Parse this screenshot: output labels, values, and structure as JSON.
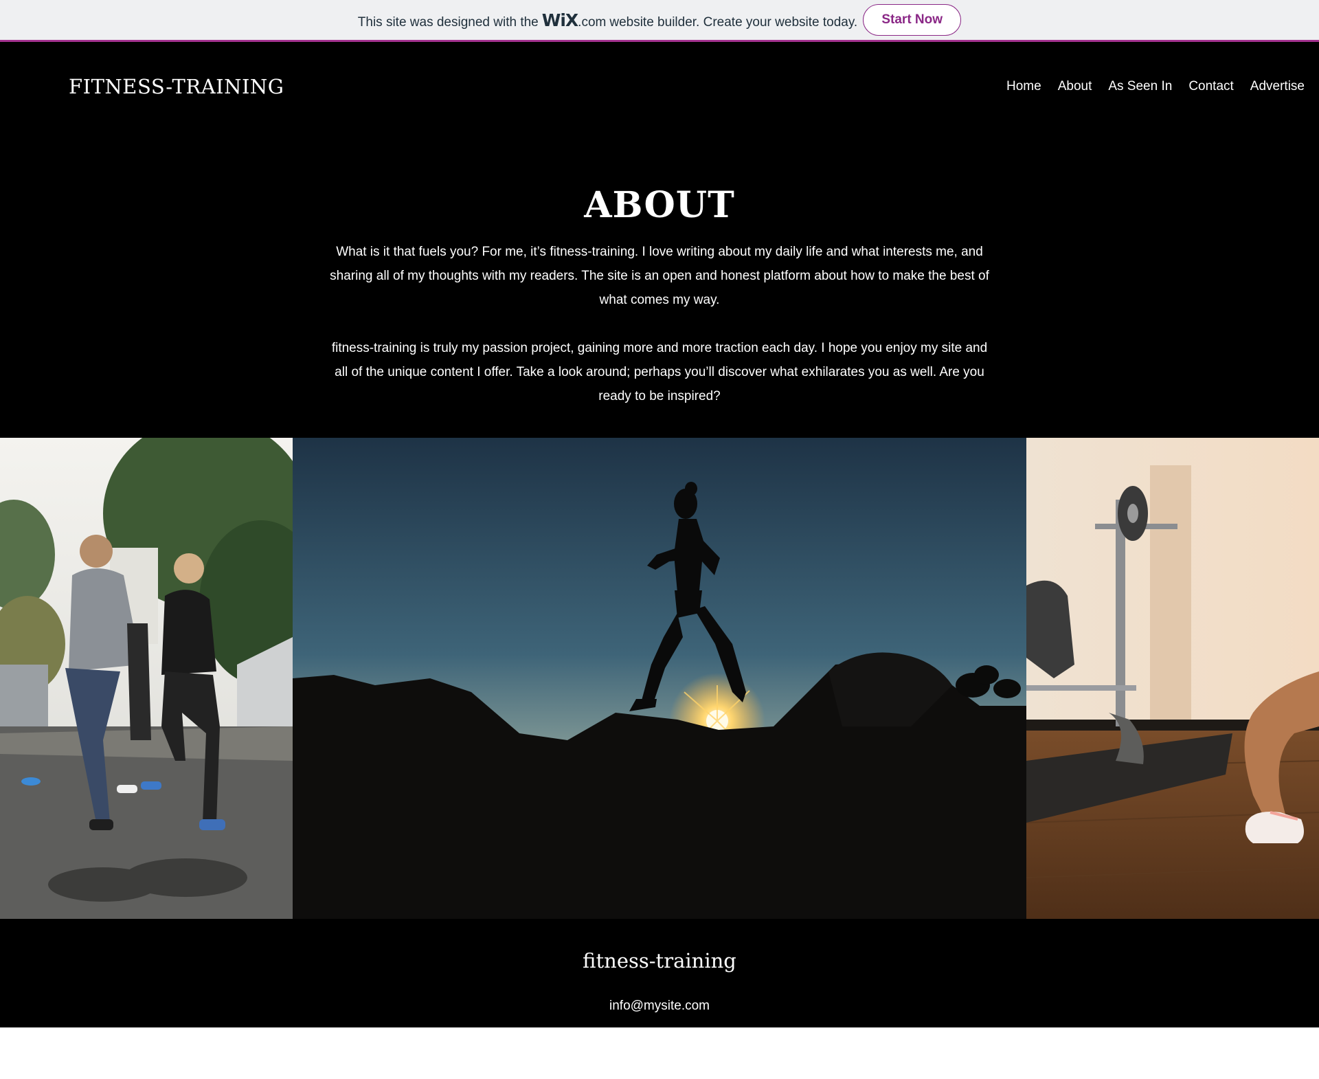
{
  "banner": {
    "prefix": "This site was designed with the",
    "logo": "WiX",
    "dotcom": ".com",
    "suffix": "website builder. Create your website today.",
    "button_label": "Start Now",
    "accent_color": "#a3328f"
  },
  "header": {
    "site_title": "FITNESS-TRAINING",
    "nav": [
      "Home",
      "About",
      "As Seen In",
      "Contact",
      "Advertise"
    ]
  },
  "about": {
    "title": "ABOUT",
    "paragraphs": [
      "What is it that fuels you? For me, it’s fitness-training. I love writing about my daily life and what interests me, and sharing all of my thoughts with my readers. The site is an open and honest platform about how to make the best of what comes my way.",
      "fitness-training is truly my passion project, gaining more and more traction each day. I hope you enjoy my site and all of the unique content I offer. Take a look around; perhaps you’ll discover what exhilarates you as well. Are you ready to be inspired?"
    ]
  },
  "gallery": {
    "images": [
      "group-running-photo",
      "sunset-runner-silhouette-photo",
      "home-gym-squat-photo"
    ]
  },
  "footer": {
    "name": "fitness-training",
    "email": "info@mysite.com"
  }
}
